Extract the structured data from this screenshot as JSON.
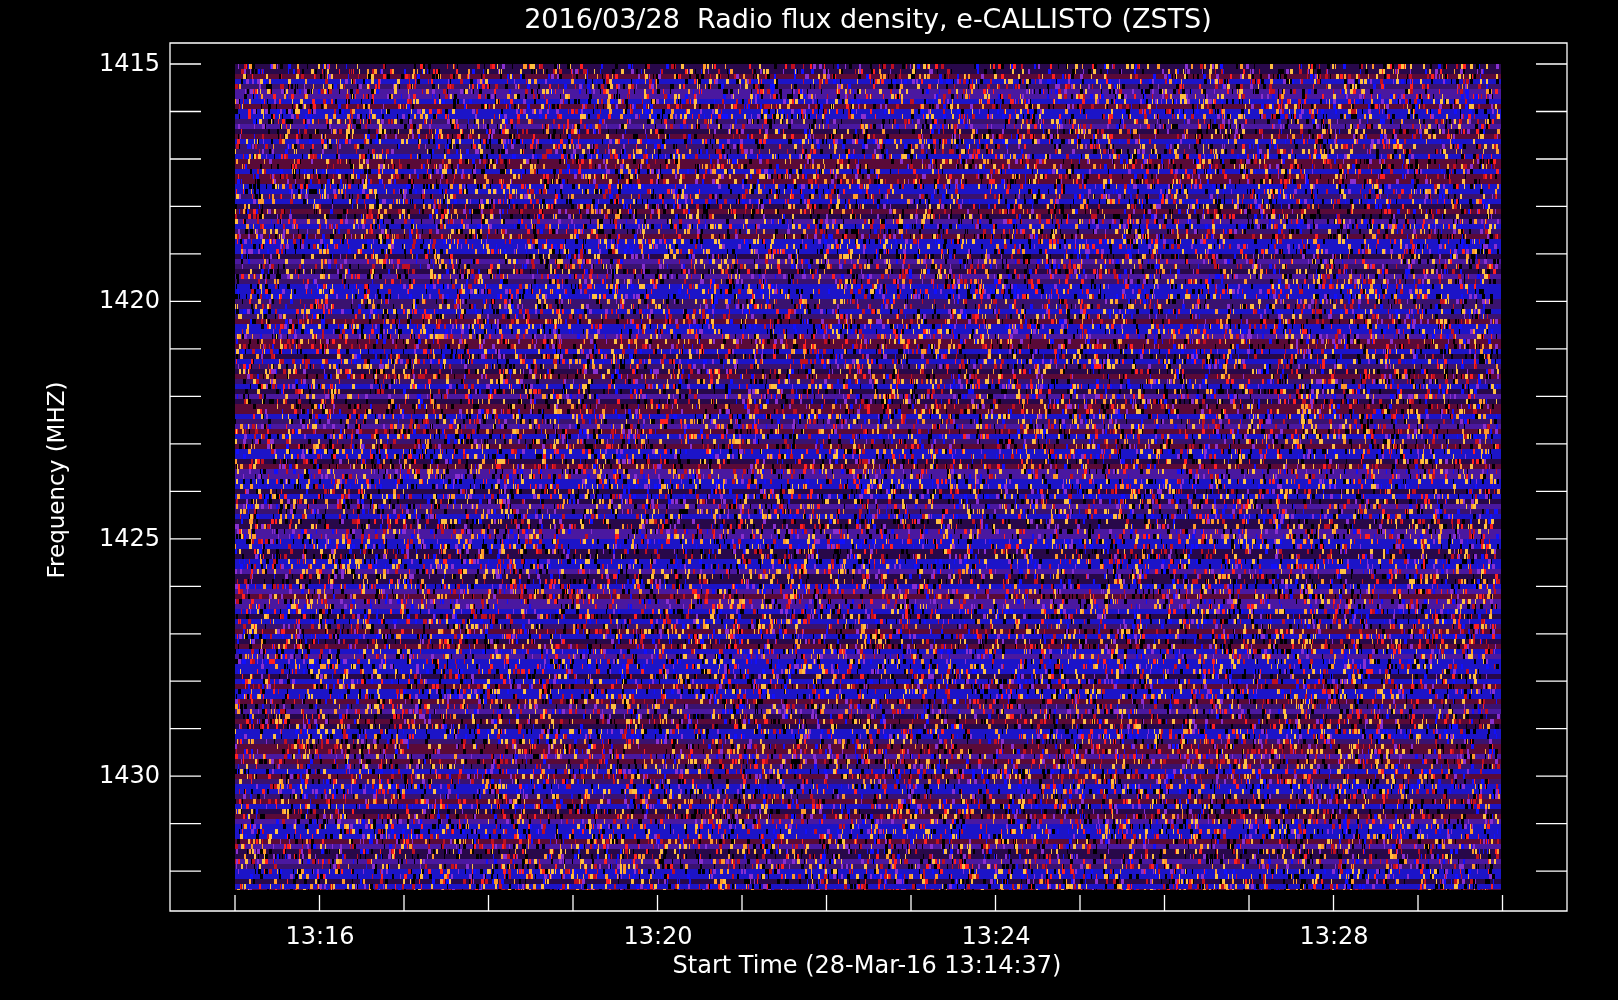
{
  "chart": {
    "title": "2016/03/28  Radio flux density, e-CALLISTO (ZSTS)",
    "ylabel": "Frequency (MHZ)",
    "xlabel": "Start Time (28-Mar-16 13:14:37)",
    "yticks": [
      "1415",
      "1420",
      "1425",
      "1430"
    ],
    "xticks": [
      "13:16",
      "13:20",
      "13:24",
      "13:28"
    ]
  }
}
